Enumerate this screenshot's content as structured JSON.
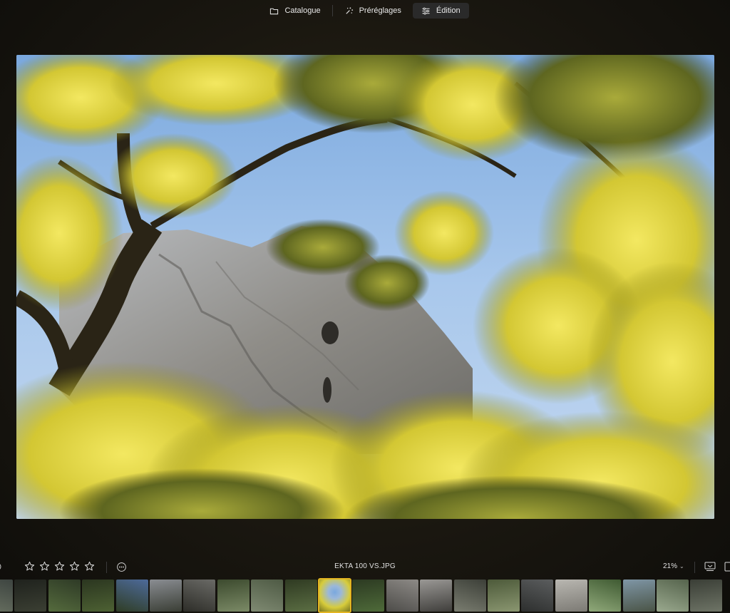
{
  "header": {
    "tabs": [
      {
        "label": "Catalogue",
        "icon": "folder-icon"
      },
      {
        "label": "Préréglages",
        "icon": "sparkle-icon"
      },
      {
        "label": "Édition",
        "icon": "sliders-icon",
        "active": true
      }
    ]
  },
  "infobar": {
    "rating": 0,
    "max_rating": 5,
    "filename": "EKTA 100 VS.JPG",
    "zoom": "21%"
  },
  "filmstrip": {
    "selected_index": 10,
    "count": 22
  },
  "colors": {
    "accent": "#e3b521"
  }
}
